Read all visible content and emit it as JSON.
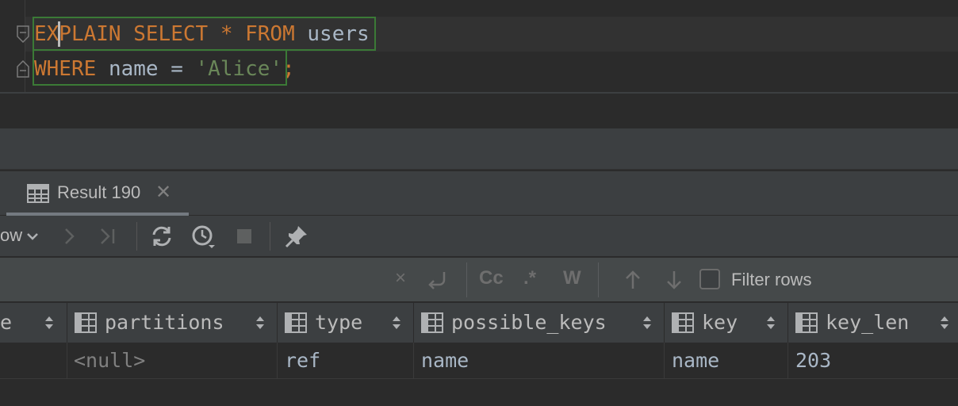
{
  "editor": {
    "line1": {
      "kw1": "EXPLAIN",
      "kw2": "SELECT",
      "star": "*",
      "kw3": "FROM",
      "table": "users"
    },
    "line2": {
      "kw1": "WHERE",
      "col": "name",
      "op": "=",
      "str": "'Alice'",
      "semi": ";"
    }
  },
  "results": {
    "tab_label": "Result 190",
    "toolbar": {
      "pagination_label": "ow"
    },
    "filter": {
      "label": "Filter rows",
      "checked": false,
      "glyphs": [
        "×",
        "Cc",
        ".*",
        "W"
      ]
    },
    "columns": [
      {
        "label": "e"
      },
      {
        "label": "partitions"
      },
      {
        "label": "type"
      },
      {
        "label": "possible_keys"
      },
      {
        "label": "key"
      },
      {
        "label": "key_len"
      }
    ],
    "rows": [
      [
        "",
        "<null>",
        "ref",
        "name",
        "name",
        "203"
      ]
    ]
  },
  "colors": {
    "keyword": "#cc7832",
    "string": "#6a8759",
    "identifier": "#a9b7c6",
    "match_border": "#3b7a36"
  },
  "icons": [
    "fold-icon",
    "table-icon",
    "close-icon",
    "chevron-down-icon",
    "next-page-icon",
    "last-page-icon",
    "refresh-icon",
    "history-icon",
    "stop-icon",
    "pin-icon",
    "undo-icon",
    "arrow-up-icon",
    "arrow-down-icon",
    "sort-icon",
    "column-icon"
  ]
}
